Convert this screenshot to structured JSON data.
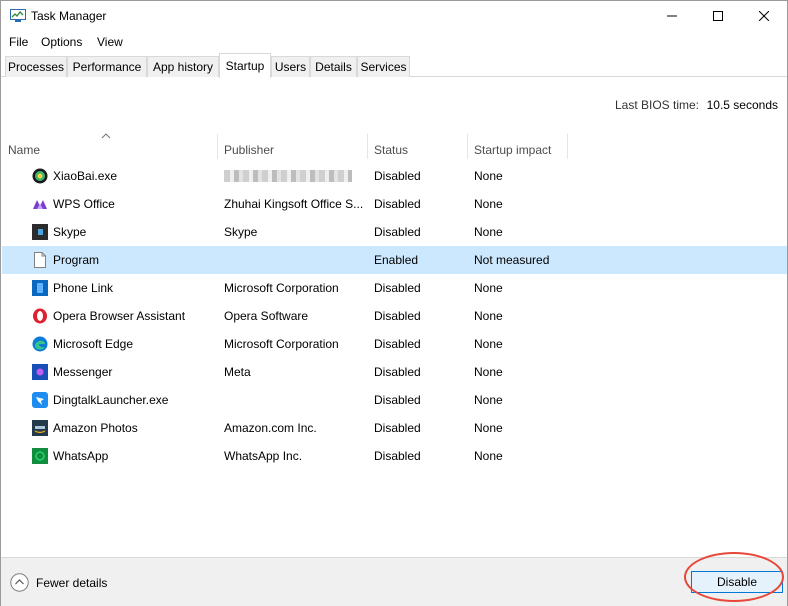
{
  "window": {
    "title": "Task Manager"
  },
  "menu": [
    "File",
    "Options",
    "View"
  ],
  "tabs": [
    "Processes",
    "Performance",
    "App history",
    "Startup",
    "Users",
    "Details",
    "Services"
  ],
  "active_tab": "Startup",
  "bios": {
    "label": "Last BIOS time:",
    "value": "10.5 seconds"
  },
  "columns": {
    "name": "Name",
    "publisher": "Publisher",
    "status": "Status",
    "impact": "Startup impact"
  },
  "rows": [
    {
      "name": "XiaoBai.exe",
      "publisher": "",
      "status": "Disabled",
      "impact": "None",
      "icon": "xiaobai-icon"
    },
    {
      "name": "WPS Office",
      "publisher": "Zhuhai Kingsoft Office S...",
      "status": "Disabled",
      "impact": "None",
      "icon": "wps-office-icon"
    },
    {
      "name": "Skype",
      "publisher": "Skype",
      "status": "Disabled",
      "impact": "None",
      "icon": "skype-icon"
    },
    {
      "name": "Program",
      "publisher": "",
      "status": "Enabled",
      "impact": "Not measured",
      "icon": "blank-file-icon"
    },
    {
      "name": "Phone Link",
      "publisher": "Microsoft Corporation",
      "status": "Disabled",
      "impact": "None",
      "icon": "phone-link-icon"
    },
    {
      "name": "Opera Browser Assistant",
      "publisher": "Opera Software",
      "status": "Disabled",
      "impact": "None",
      "icon": "opera-icon"
    },
    {
      "name": "Microsoft Edge",
      "publisher": "Microsoft Corporation",
      "status": "Disabled",
      "impact": "None",
      "icon": "edge-icon"
    },
    {
      "name": "Messenger",
      "publisher": "Meta",
      "status": "Disabled",
      "impact": "None",
      "icon": "messenger-icon"
    },
    {
      "name": "DingtalkLauncher.exe",
      "publisher": "",
      "status": "Disabled",
      "impact": "None",
      "icon": "dingtalk-icon"
    },
    {
      "name": "Amazon Photos",
      "publisher": "Amazon.com Inc.",
      "status": "Disabled",
      "impact": "None",
      "icon": "amazon-photos-icon"
    },
    {
      "name": "WhatsApp",
      "publisher": "WhatsApp Inc.",
      "status": "Disabled",
      "impact": "None",
      "icon": "whatsapp-icon"
    }
  ],
  "footer": {
    "fewer_details": "Fewer details",
    "disable_button": "Disable"
  },
  "colors": {
    "selection": "#cce8ff",
    "accent": "#0078d7",
    "highlight_ring": "#e8473a"
  }
}
